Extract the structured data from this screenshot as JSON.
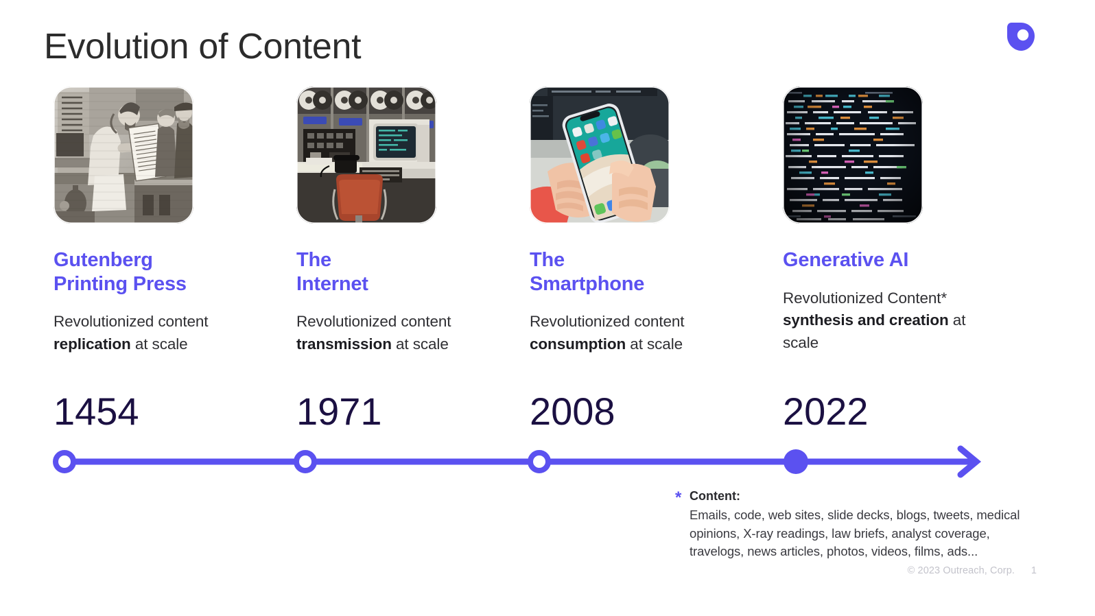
{
  "header": {
    "title": "Evolution of Content",
    "logo_name": "outreach-logo",
    "logo_color": "#5b51f0"
  },
  "theme": {
    "accent": "#5b51f0",
    "year_color": "#1b1042",
    "body_color": "#2f2f33",
    "title_color": "#2c2c2c",
    "footer_color": "#c3c3cb"
  },
  "milestones": [
    {
      "image_name": "gutenberg-printing-press-engraving",
      "title": "Gutenberg\nPrinting Press",
      "body_prefix": "Revolutionized content ",
      "body_bold": "replication",
      "body_suffix": " at scale",
      "year": "1454",
      "marker": "hollow"
    },
    {
      "image_name": "vintage-mainframe-computer-room-photo",
      "title": "The\nInternet",
      "body_prefix": "Revolutionized content ",
      "body_bold": "transmission",
      "body_suffix": " at scale",
      "year": "1971",
      "marker": "hollow"
    },
    {
      "image_name": "hands-holding-smartphone-photo",
      "title": "The\nSmartphone",
      "body_prefix": "Revolutionized content ",
      "body_bold": "consumption",
      "body_suffix": " at scale",
      "year": "2008",
      "marker": "hollow"
    },
    {
      "image_name": "source-code-on-dark-screen-photo",
      "title": "Generative AI",
      "body_prefix": "Revolutionized Content* ",
      "body_bold": "synthesis and creation",
      "body_suffix": " at scale",
      "year": "2022",
      "marker": "filled"
    }
  ],
  "footnote": {
    "star": "*",
    "label": "Content:",
    "text": "Emails, code, web sites, slide decks, blogs, tweets, medical opinions, X-ray readings, law briefs, analyst coverage, travelogs, news articles, photos, videos, films, ads..."
  },
  "footer": {
    "copyright": "© 2023 Outreach, Corp.",
    "page_number": "1"
  }
}
